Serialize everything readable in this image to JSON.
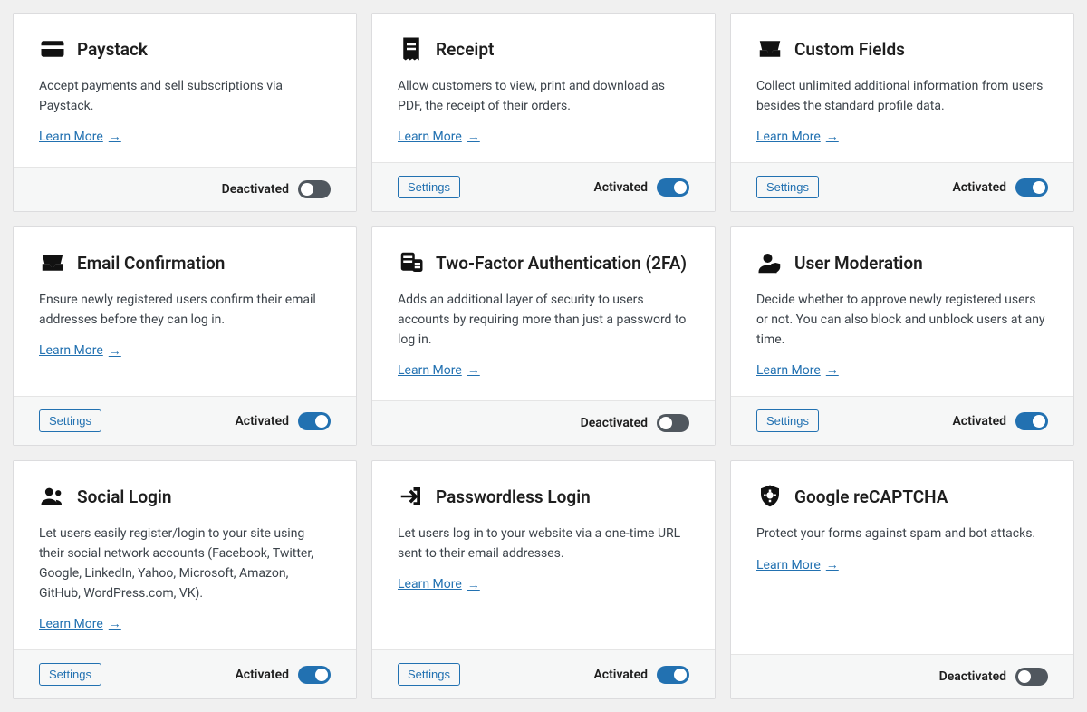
{
  "labels": {
    "learn_more": "Learn More",
    "settings": "Settings",
    "activated": "Activated",
    "deactivated": "Deactivated"
  },
  "addons": [
    {
      "icon": "credit-card",
      "title": "Paystack",
      "desc": "Accept payments and sell subscriptions via Paystack.",
      "has_settings": false,
      "active": false
    },
    {
      "icon": "receipt",
      "title": "Receipt",
      "desc": "Allow customers to view, print and download as PDF, the receipt of their orders.",
      "has_settings": true,
      "active": true
    },
    {
      "icon": "inbox",
      "title": "Custom Fields",
      "desc": "Collect unlimited additional information from users besides the standard profile data.",
      "has_settings": true,
      "active": true
    },
    {
      "icon": "inbox",
      "title": "Email Confirmation",
      "desc": "Ensure newly registered users confirm their email addresses before they can log in.",
      "has_settings": true,
      "active": true
    },
    {
      "icon": "2fa",
      "title": "Two-Factor Authentication (2FA)",
      "desc": "Adds an additional layer of security to users accounts by requiring more than just a password to log in.",
      "has_settings": false,
      "active": false
    },
    {
      "icon": "user-shield",
      "title": "User Moderation",
      "desc": "Decide whether to approve newly registered users or not. You can also block and unblock users at any time.",
      "has_settings": true,
      "active": true
    },
    {
      "icon": "users",
      "title": "Social Login",
      "desc": "Let users easily register/login to your site using their social network accounts (Facebook, Twitter, Google, LinkedIn, Yahoo, Microsoft, Amazon, GitHub, WordPress.com, VK).",
      "has_settings": true,
      "active": true
    },
    {
      "icon": "arrow-in",
      "title": "Passwordless Login",
      "desc": "Let users log in to your website via a one-time URL sent to their email addresses.",
      "has_settings": true,
      "active": true
    },
    {
      "icon": "shield-bug",
      "title": "Google reCAPTCHA",
      "desc": "Protect your forms against spam and bot attacks.",
      "has_settings": false,
      "active": false
    }
  ]
}
